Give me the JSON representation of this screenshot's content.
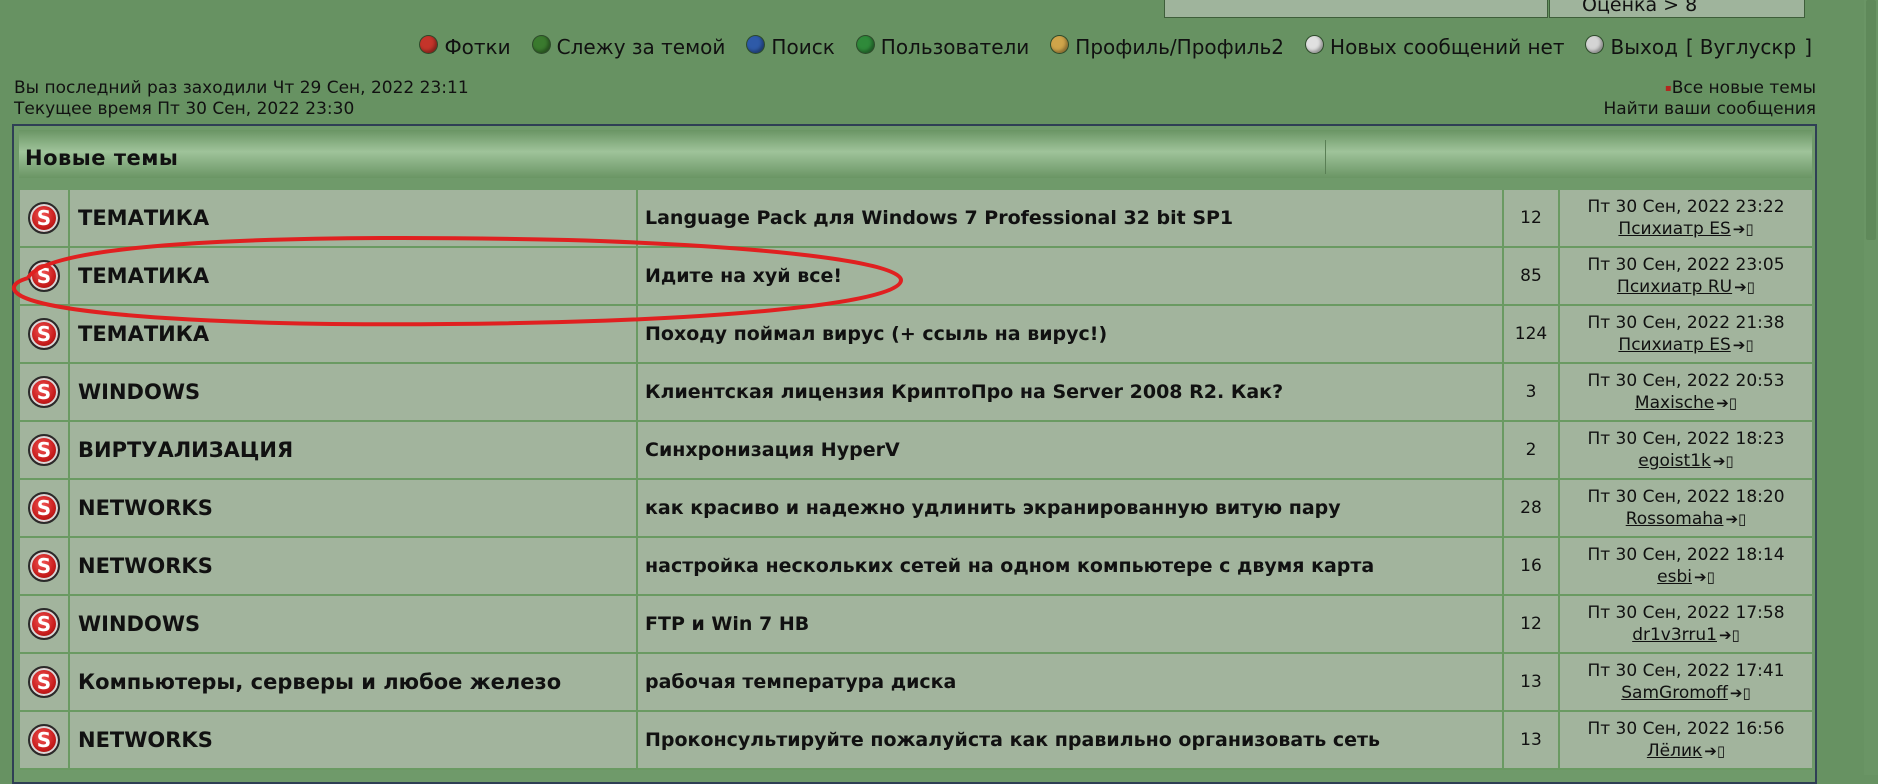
{
  "top_box": {
    "rating_text": "Оценка > 8"
  },
  "nav": {
    "items": [
      {
        "label": "Фотки",
        "icon": "photo-icon",
        "color": "#c4342a"
      },
      {
        "label": "Слежу за темой",
        "icon": "watch-topic-icon",
        "color": "#3a7a2e"
      },
      {
        "label": "Поиск",
        "icon": "search-icon",
        "color": "#2e5aa8"
      },
      {
        "label": "Пользователи",
        "icon": "users-icon",
        "color": "#2f8a3a"
      },
      {
        "label": "Профиль/Профиль2",
        "icon": "profile-icon",
        "color": "#cfa44a"
      },
      {
        "label": "Новых сообщений нет",
        "icon": "no-messages-icon",
        "color": "#e0e0e0"
      },
      {
        "label": "Выход",
        "icon": "logout-icon",
        "color": "#d4d4d4"
      }
    ],
    "bracket_open": "[",
    "user": "Вуглускр",
    "bracket_close": "]"
  },
  "info": {
    "last_visit": "Вы последний раз заходили Чт 29 Сен, 2022 23:11",
    "current_time": "Текущее время Пт 30 Сен, 2022 23:30",
    "all_new_topics": "Все новые темы",
    "find_your_posts": "Найти ваши сообщения"
  },
  "table": {
    "title": "Новые темы",
    "rows": [
      {
        "forum": "ТЕМАТИКА",
        "topic": "Language Pack для Windows 7 Professional 32 bit SP1",
        "replies": "12",
        "date": "Пт 30 Сен, 2022 23:22",
        "author": "Психиатр ES"
      },
      {
        "forum": "ТЕМАТИКА",
        "topic": "Идите на хуй все!",
        "replies": "85",
        "date": "Пт 30 Сен, 2022 23:05",
        "author": "Психиатр RU"
      },
      {
        "forum": "ТЕМАТИКА",
        "topic": "Походу поймал вирус (+ ссыль на вирус!)",
        "replies": "124",
        "date": "Пт 30 Сен, 2022 21:38",
        "author": "Психиатр ES"
      },
      {
        "forum": "WINDOWS",
        "topic": "Клиентская лицензия КриптоПро на Server 2008 R2. Как?",
        "replies": "3",
        "date": "Пт 30 Сен, 2022 20:53",
        "author": "Maxische"
      },
      {
        "forum": "ВИРТУАЛИЗАЦИЯ",
        "topic": "Синхронизация HyperV",
        "replies": "2",
        "date": "Пт 30 Сен, 2022 18:23",
        "author": "egoist1k"
      },
      {
        "forum": "NETWORKS",
        "topic": "как красиво и надежно удлинить экранированную витую пару",
        "replies": "28",
        "date": "Пт 30 Сен, 2022 18:20",
        "author": "Rossomaha"
      },
      {
        "forum": "NETWORKS",
        "topic": "настройка нескольких сетей на одном компьютере с двумя карта",
        "replies": "16",
        "date": "Пт 30 Сен, 2022 18:14",
        "author": "esbi"
      },
      {
        "forum": "WINDOWS",
        "topic": "FTP и Win 7 HB",
        "replies": "12",
        "date": "Пт 30 Сен, 2022 17:58",
        "author": "dr1v3rru1"
      },
      {
        "forum": "Компьютеры, серверы и любое железо",
        "topic": "рабочая температура диска",
        "replies": "13",
        "date": "Пт 30 Сен, 2022 17:41",
        "author": "SamGromoff"
      },
      {
        "forum": "NETWORKS",
        "topic": "Проконсультируйте пожалуйста как правильно организовать сеть",
        "replies": "13",
        "date": "Пт 30 Сен, 2022 16:56",
        "author": "Лёлик"
      }
    ]
  },
  "icons": {
    "topic_status": "unread-topic-badge-icon",
    "status_letter": "S",
    "go_last_post": "go-to-last-post-icon"
  },
  "colors": {
    "background": "#679262",
    "row": "#a2b49d",
    "frame_border": "#2f3f55",
    "annotation": "#e02020"
  }
}
